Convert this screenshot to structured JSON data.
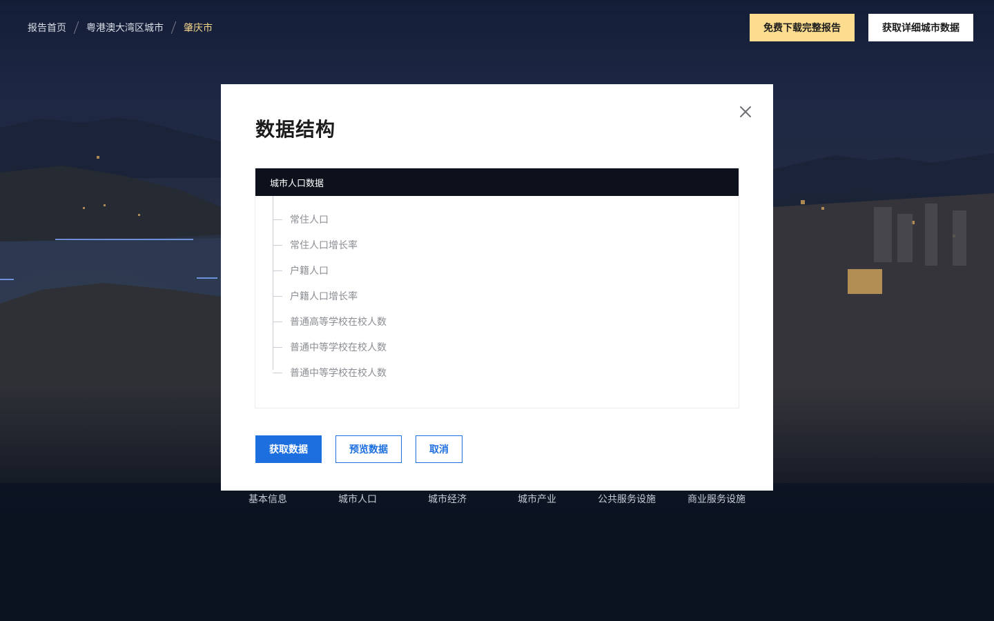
{
  "breadcrumb": {
    "home": "报告首页",
    "region": "粤港澳大湾区城市",
    "current": "肇庆市"
  },
  "header": {
    "download_label": "免费下载完整报告",
    "city_data_label": "获取详细城市数据"
  },
  "city_nav": {
    "items": [
      "基本信息",
      "城市人口",
      "城市经济",
      "城市产业",
      "公共服务设施",
      "商业服务设施"
    ]
  },
  "modal": {
    "title": "数据结构",
    "close_icon": "close-icon",
    "tree": {
      "header": "城市人口数据",
      "items": [
        "常住人口",
        "常住人口增长率",
        "户籍人口",
        "户籍人口增长率",
        "普通高等学校在校人数",
        "普通中等学校在校人数",
        "普通中等学校在校人数"
      ]
    },
    "actions": {
      "get_data": "获取数据",
      "preview_data": "预览数据",
      "cancel": "取消"
    }
  },
  "colors": {
    "accent_blue": "#1d6fe0",
    "accent_gold": "#fcdd8f",
    "current_crumb": "#f3d58a",
    "tree_header_bg": "#0c111c"
  }
}
